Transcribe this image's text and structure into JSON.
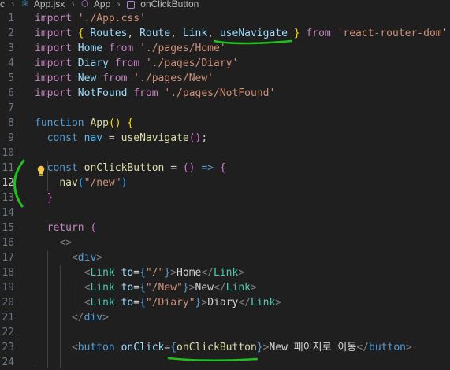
{
  "breadcrumb": {
    "lead": "c",
    "file": "App.jsx",
    "component": "App",
    "function": "onClickButton",
    "sep": "›"
  },
  "lines": [
    {
      "n": "1",
      "segs": [
        [
          "kw",
          "import"
        ],
        [
          "p",
          " "
        ],
        [
          "str",
          "'./App.css'"
        ]
      ]
    },
    {
      "n": "2",
      "segs": [
        [
          "kw",
          "import"
        ],
        [
          "p",
          " "
        ],
        [
          "br1",
          "{"
        ],
        [
          "p",
          " "
        ],
        [
          "id",
          "Routes"
        ],
        [
          "p",
          ", "
        ],
        [
          "id",
          "Route"
        ],
        [
          "p",
          ", "
        ],
        [
          "id",
          "Link"
        ],
        [
          "p",
          ", "
        ],
        [
          "id",
          "useNavigate"
        ],
        [
          "p",
          " "
        ],
        [
          "br1",
          "}"
        ],
        [
          "p",
          " "
        ],
        [
          "kw",
          "from"
        ],
        [
          "p",
          " "
        ],
        [
          "str",
          "'react-router-dom'"
        ]
      ]
    },
    {
      "n": "3",
      "segs": [
        [
          "kw",
          "import"
        ],
        [
          "p",
          " "
        ],
        [
          "id",
          "Home"
        ],
        [
          "p",
          " "
        ],
        [
          "kw",
          "from"
        ],
        [
          "p",
          " "
        ],
        [
          "str",
          "'./pages/Home'"
        ]
      ]
    },
    {
      "n": "4",
      "segs": [
        [
          "kw",
          "import"
        ],
        [
          "p",
          " "
        ],
        [
          "id",
          "Diary"
        ],
        [
          "p",
          " "
        ],
        [
          "kw",
          "from"
        ],
        [
          "p",
          " "
        ],
        [
          "str",
          "'./pages/Diary'"
        ]
      ]
    },
    {
      "n": "5",
      "segs": [
        [
          "kw",
          "import"
        ],
        [
          "p",
          " "
        ],
        [
          "id",
          "New"
        ],
        [
          "p",
          " "
        ],
        [
          "kw",
          "from"
        ],
        [
          "p",
          " "
        ],
        [
          "str",
          "'./pages/New'"
        ]
      ]
    },
    {
      "n": "6",
      "segs": [
        [
          "kw",
          "import"
        ],
        [
          "p",
          " "
        ],
        [
          "id",
          "NotFound"
        ],
        [
          "p",
          " "
        ],
        [
          "kw",
          "from"
        ],
        [
          "p",
          " "
        ],
        [
          "str",
          "'./pages/NotFound'"
        ]
      ]
    },
    {
      "n": "7",
      "segs": []
    },
    {
      "n": "8",
      "segs": [
        [
          "dk",
          "function"
        ],
        [
          "p",
          " "
        ],
        [
          "fn",
          "App"
        ],
        [
          "br1",
          "()"
        ],
        [
          "p",
          " "
        ],
        [
          "br1",
          "{"
        ]
      ]
    },
    {
      "n": "9",
      "segs": [
        [
          "p",
          "  "
        ],
        [
          "dk",
          "const"
        ],
        [
          "p",
          " "
        ],
        [
          "cst",
          "nav"
        ],
        [
          "p",
          " = "
        ],
        [
          "fn",
          "useNavigate"
        ],
        [
          "br2",
          "()"
        ],
        [
          "p",
          ";"
        ]
      ]
    },
    {
      "n": "10",
      "segs": []
    },
    {
      "n": "11",
      "segs": [
        [
          "p",
          "  "
        ],
        [
          "dk",
          "const"
        ],
        [
          "p",
          " "
        ],
        [
          "fn",
          "onClickButton"
        ],
        [
          "p",
          " = "
        ],
        [
          "br2",
          "()"
        ],
        [
          "p",
          " "
        ],
        [
          "dk",
          "=>"
        ],
        [
          "p",
          " "
        ],
        [
          "br2",
          "{"
        ]
      ]
    },
    {
      "n": "12",
      "segs": [
        [
          "p",
          "    "
        ],
        [
          "fn",
          "nav"
        ],
        [
          "br3",
          "("
        ],
        [
          "str",
          "\"/new\""
        ],
        [
          "br3",
          ")"
        ]
      ]
    },
    {
      "n": "13",
      "segs": [
        [
          "p",
          "  "
        ],
        [
          "br2",
          "}"
        ]
      ]
    },
    {
      "n": "14",
      "segs": []
    },
    {
      "n": "15",
      "segs": [
        [
          "p",
          "  "
        ],
        [
          "kw",
          "return"
        ],
        [
          "p",
          " "
        ],
        [
          "br2",
          "("
        ]
      ]
    },
    {
      "n": "16",
      "segs": [
        [
          "p",
          "    "
        ],
        [
          "tagp",
          "<>"
        ]
      ]
    },
    {
      "n": "17",
      "segs": [
        [
          "p",
          "      "
        ],
        [
          "tagp",
          "<"
        ],
        [
          "tag",
          "div"
        ],
        [
          "tagp",
          ">"
        ]
      ]
    },
    {
      "n": "18",
      "segs": [
        [
          "p",
          "        "
        ],
        [
          "tagp",
          "<"
        ],
        [
          "comp",
          "Link"
        ],
        [
          "p",
          " "
        ],
        [
          "attr",
          "to"
        ],
        [
          "p",
          "="
        ],
        [
          "dk",
          "{"
        ],
        [
          "str",
          "\"/\""
        ],
        [
          "dk",
          "}"
        ],
        [
          "tagp",
          ">"
        ],
        [
          "txt",
          "Home"
        ],
        [
          "tagp",
          "</"
        ],
        [
          "comp",
          "Link"
        ],
        [
          "tagp",
          ">"
        ]
      ]
    },
    {
      "n": "19",
      "segs": [
        [
          "p",
          "        "
        ],
        [
          "tagp",
          "<"
        ],
        [
          "comp",
          "Link"
        ],
        [
          "p",
          " "
        ],
        [
          "attr",
          "to"
        ],
        [
          "p",
          "="
        ],
        [
          "dk",
          "{"
        ],
        [
          "str",
          "\"/New\""
        ],
        [
          "dk",
          "}"
        ],
        [
          "tagp",
          ">"
        ],
        [
          "txt",
          "New"
        ],
        [
          "tagp",
          "</"
        ],
        [
          "comp",
          "Link"
        ],
        [
          "tagp",
          ">"
        ]
      ]
    },
    {
      "n": "20",
      "segs": [
        [
          "p",
          "        "
        ],
        [
          "tagp",
          "<"
        ],
        [
          "comp",
          "Link"
        ],
        [
          "p",
          " "
        ],
        [
          "attr",
          "to"
        ],
        [
          "p",
          "="
        ],
        [
          "dk",
          "{"
        ],
        [
          "str",
          "\"/Diary\""
        ],
        [
          "dk",
          "}"
        ],
        [
          "tagp",
          ">"
        ],
        [
          "txt",
          "Diary"
        ],
        [
          "tagp",
          "</"
        ],
        [
          "comp",
          "Link"
        ],
        [
          "tagp",
          ">"
        ]
      ]
    },
    {
      "n": "21",
      "segs": [
        [
          "p",
          "      "
        ],
        [
          "tagp",
          "</"
        ],
        [
          "tag",
          "div"
        ],
        [
          "tagp",
          ">"
        ]
      ]
    },
    {
      "n": "22",
      "segs": []
    },
    {
      "n": "23",
      "segs": [
        [
          "p",
          "      "
        ],
        [
          "tagp",
          "<"
        ],
        [
          "tag",
          "button"
        ],
        [
          "p",
          " "
        ],
        [
          "attr",
          "onClick"
        ],
        [
          "p",
          "="
        ],
        [
          "dk",
          "{"
        ],
        [
          "fn",
          "onClickButton"
        ],
        [
          "dk",
          "}"
        ],
        [
          "tagp",
          ">"
        ],
        [
          "txt",
          "New 페이지로 이동"
        ],
        [
          "tagp",
          "</"
        ],
        [
          "tag",
          "button"
        ],
        [
          "tagp",
          ">"
        ]
      ]
    },
    {
      "n": "24",
      "segs": []
    }
  ],
  "active_line": "12",
  "colors": {
    "background": "#1f1f1f",
    "annotation": "#22c01e",
    "bulb": "#f2c94c"
  },
  "icons": {
    "breadcrumb_react": "react-file-icon",
    "breadcrumb_component": "cube-icon",
    "breadcrumb_function": "method-icon",
    "gutter": "lightbulb-icon"
  }
}
